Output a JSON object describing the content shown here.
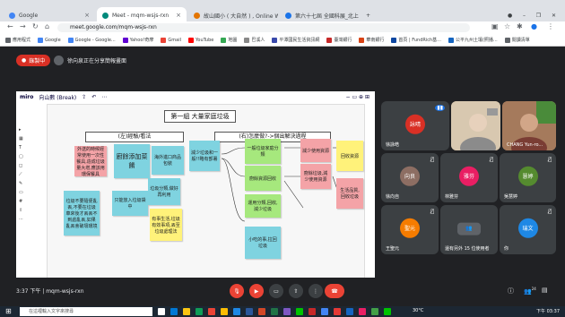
{
  "tabs": [
    {
      "label": "Google",
      "color": "#4285f4"
    },
    {
      "label": "Meet - mqm-wsjs-rxn",
      "color": "#00897b"
    },
    {
      "label": "故山國小 ( 大自然 ) , Online Wh",
      "color": "#e37400"
    },
    {
      "label": "第六十七屆 全國科展_北上排名",
      "color": "#1a73e8"
    }
  ],
  "url": "meet.google.com/mqm-wsjs-rxn",
  "bookmarks": [
    "應用程式",
    "Google",
    "Google - Google...",
    "Yahoo!奇摩",
    "Gmail",
    "YouTube",
    "地圖",
    "巴溪人",
    "平潭國民生活資訊網",
    "臺灣銀行",
    "華南銀行",
    "首頁 | FundRich基...",
    "公平九州土壤(照播...",
    "閱讀清單"
  ],
  "meet": {
    "record_label": "錄製中",
    "presenting_text": "徐向泉正在分享簡報畫面",
    "meeting_code": "3:37 下午 | mqm-wsjs-rxn",
    "more_label": "24"
  },
  "miro": {
    "logo": "miro",
    "board_name": "向山數 (Break)",
    "title": "第一組 大量家庭垃圾",
    "left_header": "(左)經驗/看法",
    "right_header": "(右)怎麼做?->個出解決過程",
    "notes": [
      {
        "text": "外送的時候經常使用一次性餐具,造成垃圾量大增,應該用環保餐具",
        "color": "#f4a3a7"
      },
      {
        "text": "廚餘添加菜餚",
        "color": "#7fd3e0"
      },
      {
        "text": "海外進口商品包裝",
        "color": "#7fd3e0"
      },
      {
        "text": "減少垃圾和一般!!略有部署",
        "color": "#7fd3e0"
      },
      {
        "text": "垃圾不要隨便亂丟,不要在垃圾車來後才丟丟不到處亂丟,如果亂丟會破壞環境",
        "color": "#7fd3e0"
      },
      {
        "text": "只能放入垃圾袋中",
        "color": "#7fd3e0"
      },
      {
        "text": "垃圾分類,做好再利用",
        "color": "#7fd3e0"
      },
      {
        "text": "有事生活,垃圾有效事項,丟至垃圾處理法",
        "color": "#fff27a"
      },
      {
        "text": "一般垃圾家庭分類",
        "color": "#a6e87d"
      },
      {
        "text": "廚餘資源回收",
        "color": "#a6e87d"
      },
      {
        "text": "運用分類,回收,減少垃圾",
        "color": "#a6e87d"
      },
      {
        "text": "減少使用資源",
        "color": "#f4a3a7"
      },
      {
        "text": "廚餘垃圾,減少使用資源",
        "color": "#f4a3a7"
      },
      {
        "text": "回收資源",
        "color": "#fff27a"
      },
      {
        "text": "生活品質,回收垃圾",
        "color": "#f4a3a7"
      },
      {
        "text": "小吃的事,拉回垃圾",
        "color": "#7fd3e0"
      }
    ]
  },
  "participants": [
    {
      "name": "徐詠皓",
      "initial": "詠晴",
      "color": "#d93025",
      "kind": "avatar"
    },
    {
      "name": "",
      "initial": "",
      "color": "#c4a882",
      "kind": "video"
    },
    {
      "name": "CHANG Yun-ro...",
      "initial": "",
      "color": "#b08a6a",
      "kind": "video"
    },
    {
      "name": "徐向自",
      "initial": "向良",
      "color": "#8d6e63",
      "kind": "avatar"
    },
    {
      "name": "林雅芬",
      "initial": "雅芬",
      "color": "#e91e63",
      "kind": "avatar"
    },
    {
      "name": "吳慧婷",
      "initial": "慧婷",
      "color": "#558b2f",
      "kind": "avatar"
    },
    {
      "name": "王聖元",
      "initial": "聖元",
      "color": "#f57c00",
      "kind": "avatar"
    },
    {
      "name": "還有另外 15 位使用者",
      "initial": "",
      "color": "#5f6368",
      "kind": "more"
    },
    {
      "name": "你",
      "initial": "瑞文",
      "color": "#1e88e5",
      "kind": "avatar"
    }
  ],
  "taskbar": {
    "search_placeholder": "在這裡輸入文字來搜尋",
    "weather": "30°C",
    "clock": "下午 03:37"
  }
}
